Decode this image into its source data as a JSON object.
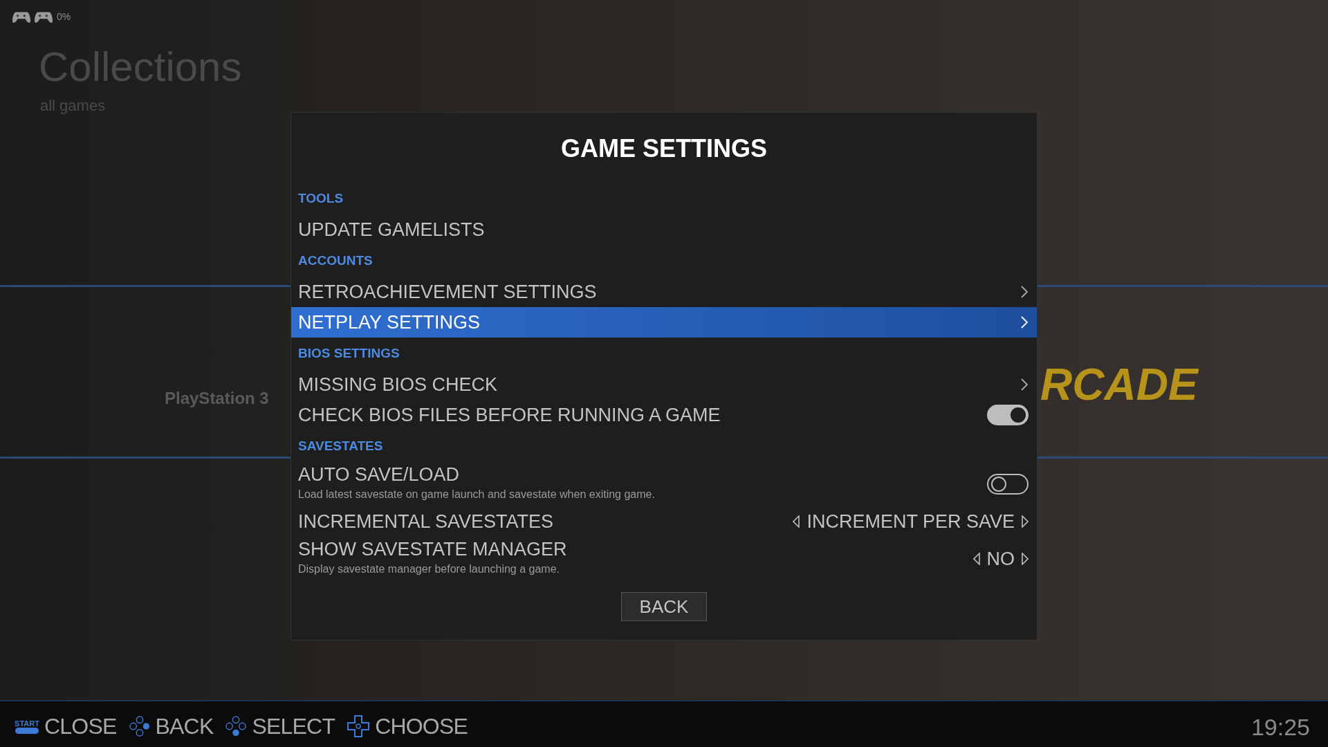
{
  "status": {
    "controllers": [
      {
        "kind": "gamepad"
      },
      {
        "kind": "gamepad"
      }
    ],
    "battery": "0%"
  },
  "view": {
    "title": "Collections",
    "subtitle": "all games"
  },
  "carousel": [
    {
      "kind": "ps3",
      "label": "PlayStation 3"
    },
    {
      "kind": "arcade",
      "label": "RCADE"
    }
  ],
  "dialog": {
    "title": "GAME SETTINGS",
    "sections": [
      {
        "header": "TOOLS",
        "items": [
          {
            "kind": "action",
            "label": "UPDATE GAMELISTS",
            "selected": false
          }
        ]
      },
      {
        "header": "ACCOUNTS",
        "items": [
          {
            "kind": "link",
            "label": "RETROACHIEVEMENT SETTINGS",
            "selected": false
          },
          {
            "kind": "link",
            "label": "NETPLAY SETTINGS",
            "selected": true
          }
        ]
      },
      {
        "header": "BIOS SETTINGS",
        "items": [
          {
            "kind": "link",
            "label": "MISSING BIOS CHECK",
            "selected": false
          },
          {
            "kind": "toggle",
            "label": "CHECK BIOS FILES BEFORE RUNNING A GAME",
            "on": true,
            "selected": false
          }
        ]
      },
      {
        "header": "SAVESTATES",
        "items": [
          {
            "kind": "toggle",
            "label": "AUTO SAVE/LOAD",
            "description": "Load latest savestate on game launch and savestate when exiting game.",
            "on": false,
            "selected": false
          },
          {
            "kind": "option",
            "label": "INCREMENTAL SAVESTATES",
            "value": "INCREMENT PER SAVE",
            "selected": false
          },
          {
            "kind": "option",
            "label": "SHOW SAVESTATE MANAGER",
            "value": "NO",
            "description": "Display savestate manager before launching a game.",
            "selected": false
          }
        ]
      }
    ],
    "button": "BACK"
  },
  "help": [
    {
      "kind": "start",
      "key": "START",
      "label": "CLOSE"
    },
    {
      "kind": "east",
      "label": "BACK"
    },
    {
      "kind": "south",
      "label": "SELECT"
    },
    {
      "kind": "dpad",
      "label": "CHOOSE"
    }
  ],
  "clock": "19:25"
}
